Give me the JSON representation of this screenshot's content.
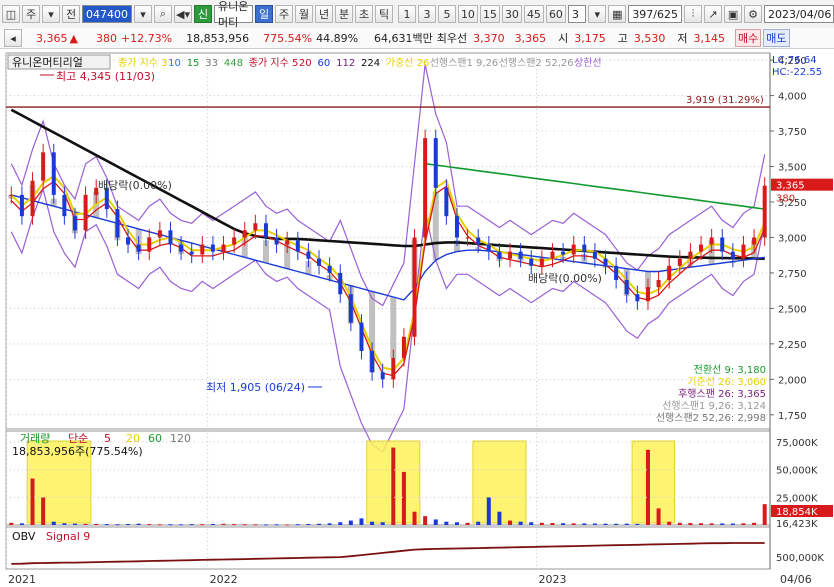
{
  "toolbar": {
    "period_type": "주",
    "view_mode": "전",
    "stock_code": "047400",
    "badge_new": "신",
    "stock_name": "유니온머티",
    "periods": [
      "일",
      "주",
      "월",
      "년",
      "분",
      "초",
      "틱"
    ],
    "active_period": "일",
    "intervals": [
      "1",
      "3",
      "5",
      "10",
      "15",
      "30",
      "45",
      "60"
    ],
    "interval_input": "3",
    "count": "397/625",
    "date": "2023/04/06"
  },
  "quote": {
    "price": "3,365",
    "change_arrow": "▲",
    "change": "380",
    "change_pct": "+12.73%",
    "volume": "18,853,956",
    "volume_ratio": "775.54%",
    "turnover": "44.89%",
    "amount": "64,631백만",
    "best_ask_label": "최우선",
    "best_ask": "3,370",
    "best_bid": "3,365",
    "open_label": "시",
    "open": "3,175",
    "high_label": "고",
    "high": "3,530",
    "low_label": "저",
    "low": "3,145",
    "buy_btn": "매수",
    "sell_btn": "매도"
  },
  "colors": {
    "up": "#d81a1a",
    "down": "#1a3ad8",
    "ma5": "#d81a1a",
    "ma20": "#1a3ad8",
    "ma60": "#139a2e",
    "ma112": "#7a1f7a",
    "ma224": "#111111",
    "band": "#9a5fd6",
    "cloud": "#8c8c8c",
    "highlight": "#fff25a"
  },
  "chart_data": [
    {
      "type": "line",
      "title": "유니온머티리얼",
      "x_ticks": [
        "2021",
        "2022",
        "2023",
        "04/06"
      ],
      "ylim": [
        1650,
        4300
      ],
      "y_ticks": [
        1750,
        2000,
        2250,
        2500,
        2750,
        3000,
        3250,
        3500,
        3750,
        4000,
        4250
      ],
      "y_tick_labels": [
        "1,750",
        "2,000",
        "2,250",
        "2,500",
        "2,750",
        "3,000",
        "3,250",
        "3,500",
        "3,750",
        "4,000",
        "4,250"
      ],
      "legend": {
        "simple_label": "종가 지수 3",
        "simple_periods": [
          "10",
          "15",
          "33",
          "448"
        ],
        "exp_label": "종가 지수 5",
        "exp_periods": [
          "20",
          "60",
          "112",
          "224"
        ],
        "price_line": "가중선 26",
        "span1": "선행스팬1 9,26",
        "span2": "선행스팬2 52,26",
        "upper": "상한선"
      },
      "lc": "LC:76.64",
      "hc": "HC:-22.55",
      "annotations": {
        "high": "최고 4,345 (11/03)",
        "low": "최저 1,905 (06/24)",
        "dividend1": "배당락(0.00%)",
        "dividend2": "배당락(0.00%)",
        "hline_label": "3,919 (31.29%)",
        "hline_value": 3919,
        "last_price_tag": "3,365",
        "change_tag": "380"
      },
      "ichimoku": {
        "conversion": "전환선 9: 3,180",
        "base": "기준선 26: 3,060",
        "lagging": "후행스팬 26: 3,365",
        "span1": "선행스팬1 9,26: 3,124",
        "span2": "선행스팬2 52,26: 2,998"
      },
      "close_series": [
        3300,
        3150,
        3400,
        3600,
        3300,
        3150,
        3050,
        3300,
        3350,
        3200,
        3000,
        2950,
        2900,
        3000,
        3050,
        2950,
        2900,
        2880,
        2950,
        2900,
        2950,
        3000,
        3050,
        3100,
        3000,
        2950,
        2980,
        2900,
        2850,
        2800,
        2750,
        2600,
        2400,
        2200,
        2050,
        2000,
        2150,
        2300,
        3000,
        3700,
        3350,
        3150,
        3000,
        3000,
        2950,
        2900,
        2850,
        2900,
        2850,
        2800,
        2850,
        2900,
        2880,
        2950,
        2900,
        2850,
        2800,
        2700,
        2600,
        2550,
        2650,
        2700,
        2800,
        2850,
        2900,
        2950,
        3000,
        2900,
        2850,
        2950,
        3000,
        3365
      ],
      "ma224_series": [
        3900,
        3860,
        3820,
        3780,
        3740,
        3700,
        3660,
        3620,
        3580,
        3540,
        3500,
        3460,
        3420,
        3380,
        3340,
        3300,
        3260,
        3220,
        3180,
        3140,
        3100,
        3060,
        3030,
        3010,
        3000,
        2990,
        2990,
        2990,
        2985,
        2980,
        2975,
        2970,
        2965,
        2960,
        2955,
        2950,
        2945,
        2940,
        2940,
        2950,
        2960,
        2965,
        2965,
        2960,
        2955,
        2950,
        2945,
        2940,
        2935,
        2930,
        2925,
        2920,
        2915,
        2910,
        2905,
        2900,
        2895,
        2890,
        2885,
        2880,
        2875,
        2870,
        2865,
        2862,
        2860,
        2858,
        2856,
        2855,
        2854,
        2853,
        2852,
        2850
      ],
      "ma112_series": [
        3300,
        3280,
        3260,
        3240,
        3220,
        3200,
        3180,
        3160,
        3140,
        3120,
        3100,
        3080,
        3060,
        3040,
        3020,
        3000,
        2980,
        2960,
        2940,
        2920,
        2900,
        2880,
        2860,
        2840,
        2820,
        2800,
        2780,
        2760,
        2740,
        2720,
        2700,
        2680,
        2660,
        2640,
        2620,
        2600,
        2580,
        2560,
        2640,
        2760,
        2840,
        2880,
        2900,
        2910,
        2910,
        2905,
        2900,
        2890,
        2880,
        2870,
        2860,
        2850,
        2840,
        2830,
        2820,
        2810,
        2800,
        2790,
        2780,
        2770,
        2760,
        2760,
        2770,
        2780,
        2790,
        2800,
        2810,
        2820,
        2830,
        2840,
        2850,
        2860
      ],
      "ma60_series": [
        null,
        null,
        null,
        null,
        null,
        null,
        null,
        null,
        null,
        null,
        null,
        null,
        null,
        null,
        null,
        null,
        null,
        null,
        null,
        null,
        null,
        null,
        null,
        null,
        null,
        null,
        null,
        null,
        null,
        null,
        null,
        null,
        null,
        null,
        null,
        null,
        null,
        null,
        null,
        3520,
        3510,
        3500,
        3490,
        3480,
        3470,
        3460,
        3450,
        3440,
        3430,
        3420,
        3410,
        3400,
        3390,
        3380,
        3370,
        3360,
        3350,
        3340,
        3330,
        3320,
        3310,
        3300,
        3290,
        3280,
        3270,
        3260,
        3250,
        3240,
        3230,
        3220,
        3210,
        3200
      ]
    },
    {
      "type": "bar",
      "title": "거래량",
      "legend": {
        "label": "단순",
        "periods": [
          "5",
          "20",
          "60",
          "120"
        ]
      },
      "current": "18,853,956주(775.54%)",
      "y_tick_labels": [
        "75,000K",
        "50,000K",
        "25,000K"
      ],
      "y_ticks": [
        75000,
        50000,
        25000
      ],
      "ylim": [
        0,
        85000
      ],
      "last_tag": "18,854K",
      "avg_tag": "16,423K",
      "highlight_windows": [
        [
          2,
          8
        ],
        [
          34,
          39
        ],
        [
          44,
          49
        ],
        [
          59,
          63
        ]
      ],
      "volume_series": [
        2000,
        1500,
        42000,
        25000,
        3000,
        1500,
        1200,
        1000,
        900,
        800,
        700,
        900,
        1200,
        800,
        600,
        700,
        600,
        800,
        700,
        900,
        1100,
        800,
        700,
        600,
        500,
        600,
        500,
        700,
        900,
        1100,
        1500,
        2500,
        4000,
        6000,
        3000,
        2500,
        70000,
        48000,
        12000,
        8000,
        5000,
        3000,
        2500,
        2000,
        3000,
        25000,
        12000,
        4000,
        3000,
        2500,
        2000,
        1800,
        1600,
        1500,
        1400,
        1300,
        1200,
        1100,
        1200,
        1000,
        68000,
        15000,
        3000,
        2000,
        1800,
        1600,
        1500,
        1400,
        1300,
        1500,
        2000,
        18854
      ]
    },
    {
      "type": "line",
      "title": "OBV",
      "signal": "Signal 9",
      "y_tick_labels": [
        "500,000K"
      ],
      "obv_series": [
        0.05,
        0.06,
        0.08,
        0.09,
        0.1,
        0.11,
        0.11,
        0.12,
        0.13,
        0.14,
        0.15,
        0.16,
        0.17,
        0.18,
        0.19,
        0.2,
        0.21,
        0.22,
        0.23,
        0.24,
        0.25,
        0.26,
        0.27,
        0.28,
        0.29,
        0.3,
        0.31,
        0.32,
        0.33,
        0.34,
        0.35,
        0.36,
        0.4,
        0.45,
        0.5,
        0.55,
        0.6,
        0.65,
        0.7,
        0.72,
        0.73,
        0.74,
        0.75,
        0.76,
        0.77,
        0.78,
        0.79,
        0.8,
        0.81,
        0.82,
        0.83,
        0.84,
        0.85,
        0.86,
        0.87,
        0.88,
        0.89,
        0.9,
        0.91,
        0.92,
        0.93,
        0.94,
        0.95,
        0.96,
        0.97,
        0.98,
        0.99,
        0.99,
        1.0,
        1.0,
        1.0,
        1.0
      ]
    }
  ]
}
